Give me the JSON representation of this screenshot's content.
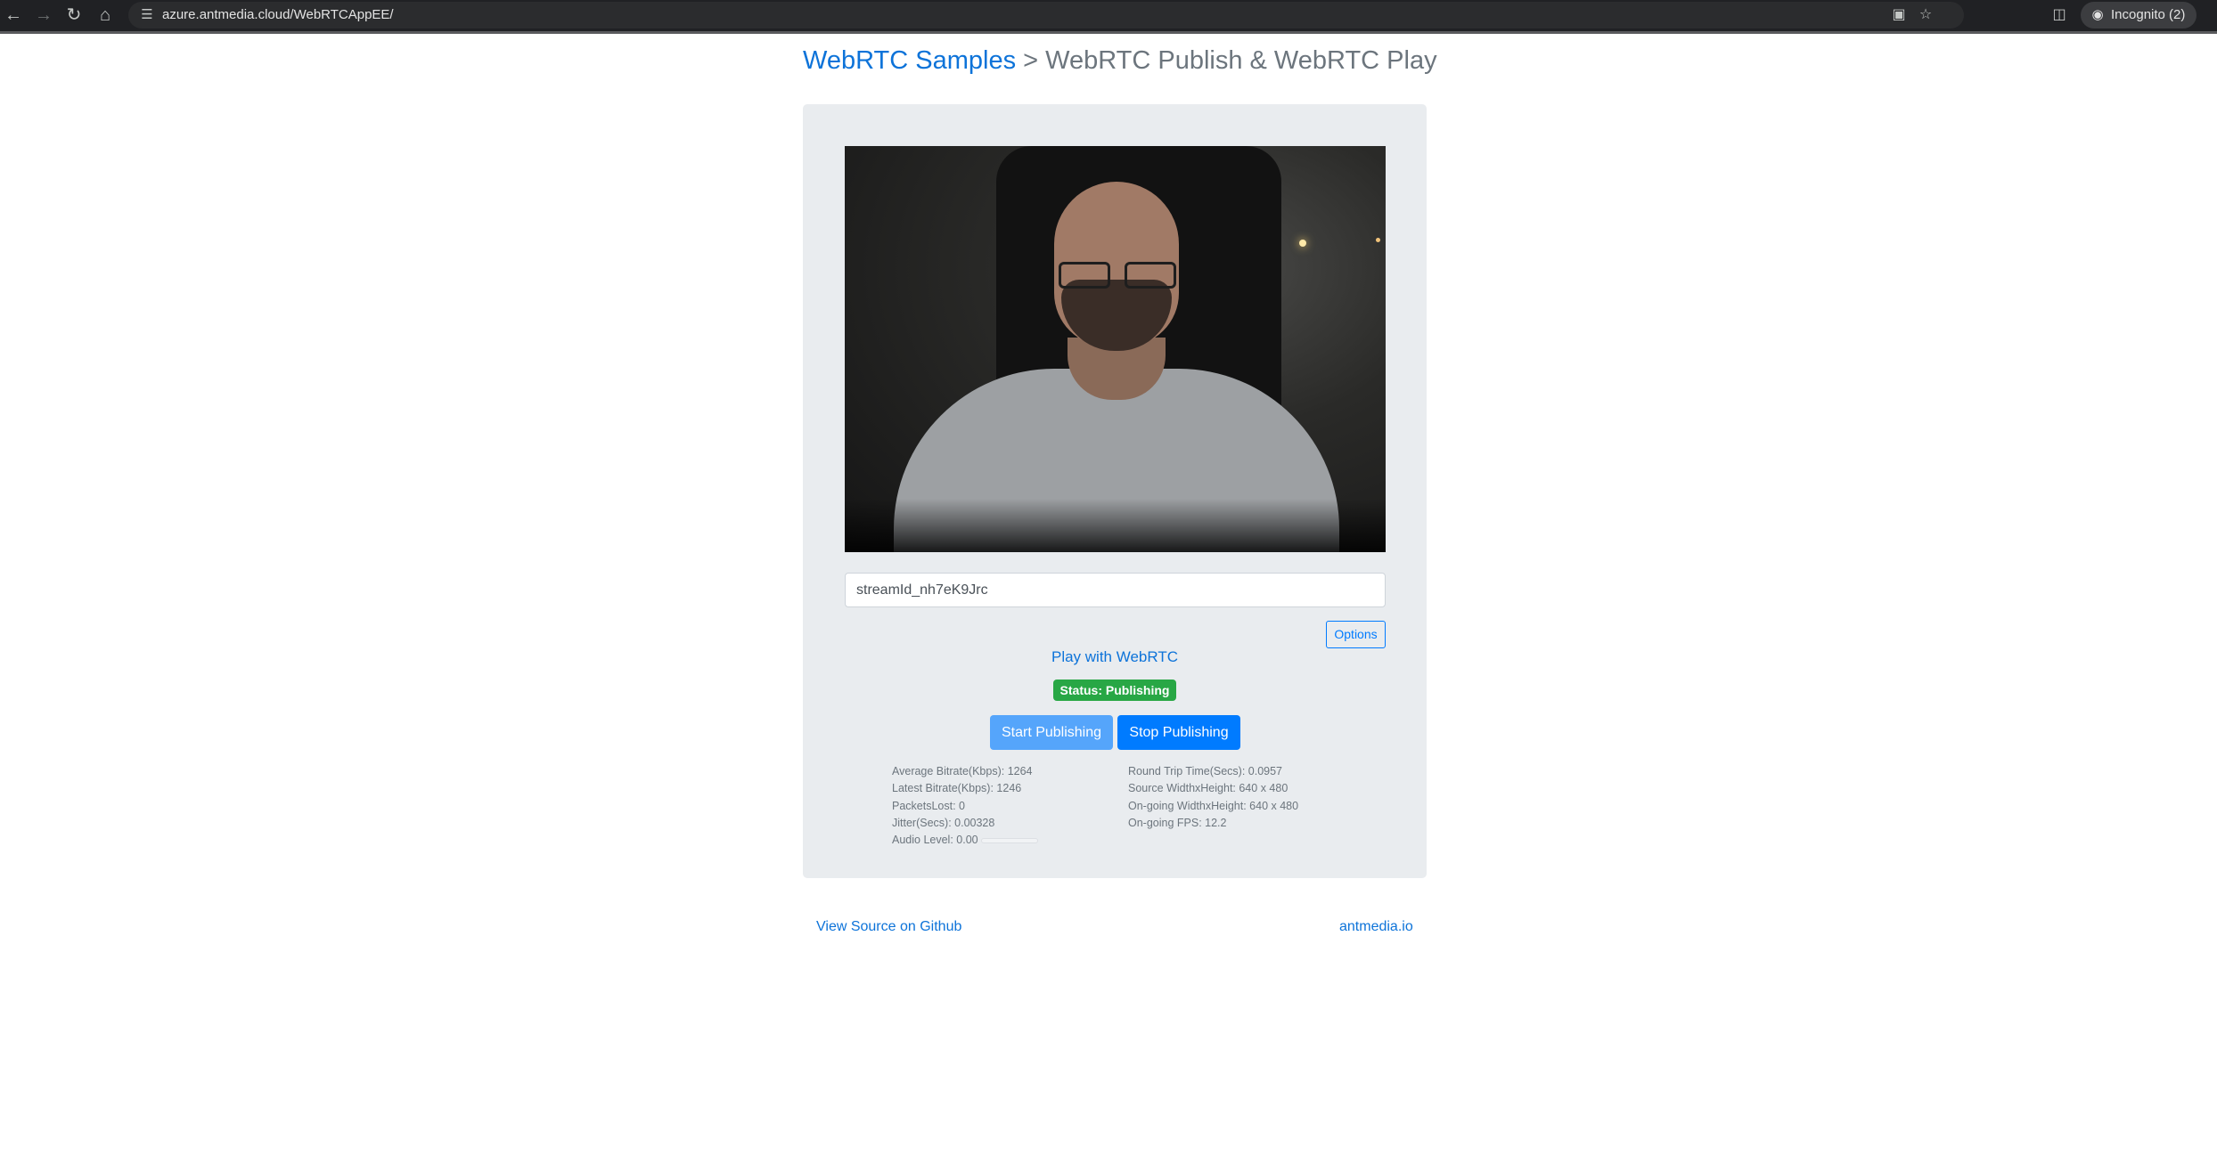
{
  "browser": {
    "url": "azure.antmedia.cloud/WebRTCAppEE/",
    "incognito_label": "Incognito (2)",
    "icons": [
      "back-arrow-icon",
      "forward-arrow-icon",
      "reload-icon",
      "home-icon",
      "site-settings-icon",
      "camera-in-use-icon",
      "bookmark-star-icon",
      "side-panel-icon",
      "incognito-icon"
    ]
  },
  "page": {
    "breadcrumb_link": "WebRTC Samples",
    "breadcrumb_rest": " > WebRTC Publish & WebRTC Play"
  },
  "publisher": {
    "stream_id_value": "streamId_nh7eK9Jrc",
    "options_label": "Options",
    "play_link": "Play with WebRTC",
    "status": "Status: Publishing",
    "status_color": "#28a745",
    "start_label": "Start Publishing",
    "stop_label": "Stop Publishing",
    "stats_left": {
      "average_bitrate": "Average Bitrate(Kbps): 1264",
      "latest_bitrate": "Latest Bitrate(Kbps): 1246",
      "packets_lost": "PacketsLost: 0",
      "jitter": "Jitter(Secs): 0.00328",
      "audio_level": "Audio Level: 0.00",
      "audio_level_fraction": 0.0
    },
    "stats_right": {
      "round_trip": "Round Trip Time(Secs): 0.0957",
      "source_size": "Source WidthxHeight: 640 x 480",
      "ongoing_size": "On-going WidthxHeight: 640 x 480",
      "ongoing_fps": "On-going FPS: 12.2"
    }
  },
  "footer": {
    "github_link": "View Source on Github",
    "site_link": "antmedia.io"
  },
  "colors": {
    "link": "#0d73d9",
    "primary": "#007bff",
    "card_bg": "#e9ecef"
  }
}
